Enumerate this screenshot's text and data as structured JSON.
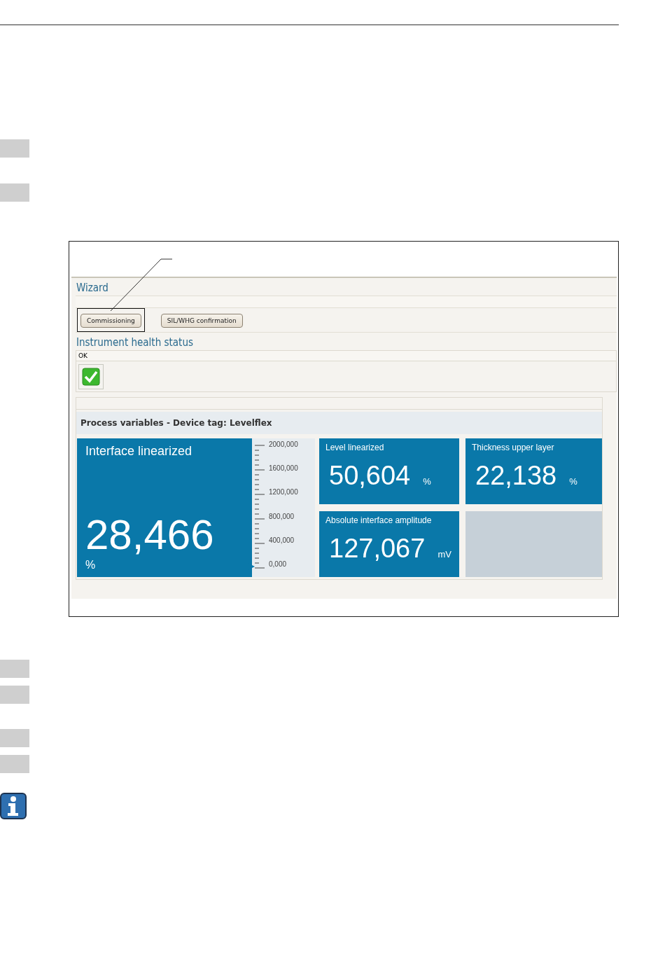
{
  "figure": {
    "wizard": {
      "title": "Wizard",
      "buttons": [
        {
          "label": "Commissioning",
          "highlighted": true
        },
        {
          "label": "SIL/WHG confirmation",
          "highlighted": false
        }
      ]
    },
    "health": {
      "title": "Instrument health status",
      "status": "OK"
    },
    "process_variables": {
      "title": "Process variables - Device tag: Levelflex",
      "main_tile": {
        "label": "Interface linearized",
        "value": "28,466",
        "unit": "%",
        "scale": [
          "2000,000",
          "1600,000",
          "1200,000",
          "800,000",
          "400,000",
          "0,000"
        ]
      },
      "tiles": [
        {
          "kind": "value",
          "label": "Level linearized",
          "value": "50,604",
          "unit": "%"
        },
        {
          "kind": "value",
          "label": "Thickness upper layer",
          "value": "22,138",
          "unit": "%"
        },
        {
          "kind": "value",
          "label": "Absolute interface amplitude",
          "value": "127,067",
          "unit": "mV"
        },
        {
          "kind": "empty"
        }
      ]
    }
  }
}
